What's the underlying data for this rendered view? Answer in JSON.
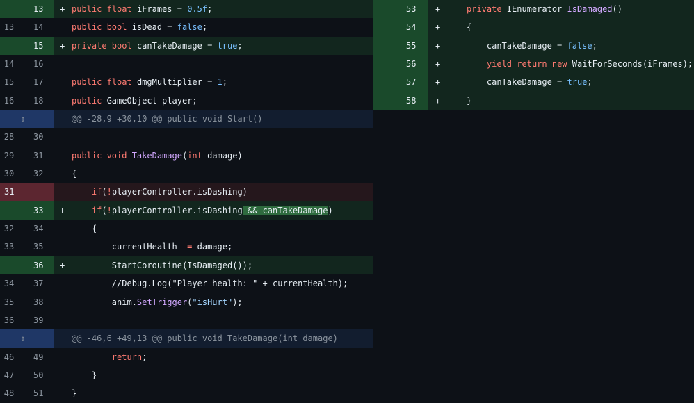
{
  "left_pane": {
    "rows": [
      {
        "type": "add",
        "old": "",
        "new": "13",
        "sign": "+",
        "code": [
          {
            "t": "public ",
            "c": "kw"
          },
          {
            "t": "float ",
            "c": "kw"
          },
          {
            "t": "iFrames = ",
            "c": ""
          },
          {
            "t": "0.5f",
            "c": "num-l"
          },
          {
            "t": ";",
            "c": ""
          }
        ]
      },
      {
        "type": "ctx",
        "old": "13",
        "new": "14",
        "sign": "",
        "code": [
          {
            "t": "public ",
            "c": "kw"
          },
          {
            "t": "bool ",
            "c": "kw"
          },
          {
            "t": "isDead = ",
            "c": ""
          },
          {
            "t": "false",
            "c": "num-l"
          },
          {
            "t": ";",
            "c": ""
          }
        ]
      },
      {
        "type": "add",
        "old": "",
        "new": "15",
        "sign": "+",
        "code": [
          {
            "t": "private ",
            "c": "kw"
          },
          {
            "t": "bool ",
            "c": "kw"
          },
          {
            "t": "canTakeDamage = ",
            "c": ""
          },
          {
            "t": "true",
            "c": "num-l"
          },
          {
            "t": ";",
            "c": ""
          }
        ]
      },
      {
        "type": "ctx",
        "old": "14",
        "new": "16",
        "sign": "",
        "code": []
      },
      {
        "type": "ctx",
        "old": "15",
        "new": "17",
        "sign": "",
        "code": [
          {
            "t": "public ",
            "c": "kw"
          },
          {
            "t": "float ",
            "c": "kw"
          },
          {
            "t": "dmgMultiplier = ",
            "c": ""
          },
          {
            "t": "1",
            "c": "num-l"
          },
          {
            "t": ";",
            "c": ""
          }
        ]
      },
      {
        "type": "ctx",
        "old": "16",
        "new": "18",
        "sign": "",
        "code": [
          {
            "t": "public ",
            "c": "kw"
          },
          {
            "t": "GameObject player;",
            "c": ""
          }
        ]
      },
      {
        "type": "hunk",
        "old": "",
        "new": "",
        "sign": "",
        "code": [
          {
            "t": "@@ -28,9 +30,10 @@ public void Start()",
            "c": ""
          }
        ]
      },
      {
        "type": "ctx",
        "old": "28",
        "new": "30",
        "sign": "",
        "code": []
      },
      {
        "type": "ctx",
        "old": "29",
        "new": "31",
        "sign": "",
        "code": [
          {
            "t": "public ",
            "c": "kw"
          },
          {
            "t": "void ",
            "c": "kw"
          },
          {
            "t": "TakeDamage",
            "c": "fn"
          },
          {
            "t": "(",
            "c": ""
          },
          {
            "t": "int ",
            "c": "kw"
          },
          {
            "t": "damage)",
            "c": ""
          }
        ]
      },
      {
        "type": "ctx",
        "old": "30",
        "new": "32",
        "sign": "",
        "code": [
          {
            "t": "{",
            "c": ""
          }
        ]
      },
      {
        "type": "del",
        "old": "31",
        "new": "",
        "sign": "-",
        "code": [
          {
            "t": "    ",
            "c": ""
          },
          {
            "t": "if",
            "c": "kw"
          },
          {
            "t": "(",
            "c": ""
          },
          {
            "t": "!",
            "c": "kw"
          },
          {
            "t": "playerController.isDashing)",
            "c": ""
          }
        ]
      },
      {
        "type": "add",
        "old": "",
        "new": "33",
        "sign": "+",
        "code": [
          {
            "t": "    ",
            "c": ""
          },
          {
            "t": "if",
            "c": "kw"
          },
          {
            "t": "(",
            "c": ""
          },
          {
            "t": "!",
            "c": "kw"
          },
          {
            "t": "playerController.isDashing",
            "c": ""
          },
          {
            "t": " && canTakeDamage",
            "c": "hl"
          },
          {
            "t": ")",
            "c": ""
          }
        ]
      },
      {
        "type": "ctx",
        "old": "32",
        "new": "34",
        "sign": "",
        "code": [
          {
            "t": "    {",
            "c": ""
          }
        ]
      },
      {
        "type": "ctx",
        "old": "33",
        "new": "35",
        "sign": "",
        "code": [
          {
            "t": "        currentHealth ",
            "c": ""
          },
          {
            "t": "-=",
            "c": "kw"
          },
          {
            "t": " damage;",
            "c": ""
          }
        ]
      },
      {
        "type": "add",
        "old": "",
        "new": "36",
        "sign": "+",
        "code": [
          {
            "t": "        StartCoroutine(IsDamaged());",
            "c": ""
          }
        ]
      },
      {
        "type": "ctx",
        "old": "34",
        "new": "37",
        "sign": "",
        "code": [
          {
            "t": "        //Debug.Log(\"Player health: \" + currentHealth);",
            "c": "cm"
          }
        ]
      },
      {
        "type": "ctx",
        "old": "35",
        "new": "38",
        "sign": "",
        "code": [
          {
            "t": "        anim.",
            "c": ""
          },
          {
            "t": "SetTrigger",
            "c": "fn"
          },
          {
            "t": "(",
            "c": ""
          },
          {
            "t": "\"isHurt\"",
            "c": "str"
          },
          {
            "t": ");",
            "c": ""
          }
        ]
      },
      {
        "type": "ctx",
        "old": "36",
        "new": "39",
        "sign": "",
        "code": []
      },
      {
        "type": "hunk",
        "old": "",
        "new": "",
        "sign": "",
        "code": [
          {
            "t": "@@ -46,6 +49,13 @@ public void TakeDamage(int damage)",
            "c": ""
          }
        ]
      },
      {
        "type": "ctx",
        "old": "46",
        "new": "49",
        "sign": "",
        "code": [
          {
            "t": "        ",
            "c": ""
          },
          {
            "t": "return",
            "c": "kw"
          },
          {
            "t": ";",
            "c": ""
          }
        ]
      },
      {
        "type": "ctx",
        "old": "47",
        "new": "50",
        "sign": "",
        "code": [
          {
            "t": "    }",
            "c": ""
          }
        ]
      },
      {
        "type": "ctx",
        "old": "48",
        "new": "51",
        "sign": "",
        "code": [
          {
            "t": "}",
            "c": ""
          }
        ]
      }
    ]
  },
  "right_pane": {
    "rows": [
      {
        "type": "add",
        "new": "53",
        "sign": "+",
        "code": [
          {
            "t": "private ",
            "c": "kw"
          },
          {
            "t": "IEnumerator ",
            "c": ""
          },
          {
            "t": "IsDamaged",
            "c": "fn"
          },
          {
            "t": "()",
            "c": ""
          }
        ]
      },
      {
        "type": "add",
        "new": "54",
        "sign": "+",
        "code": [
          {
            "t": "{",
            "c": ""
          }
        ]
      },
      {
        "type": "add",
        "new": "55",
        "sign": "+",
        "code": [
          {
            "t": "    canTakeDamage = ",
            "c": ""
          },
          {
            "t": "false",
            "c": "num-l"
          },
          {
            "t": ";",
            "c": ""
          }
        ]
      },
      {
        "type": "add",
        "new": "56",
        "sign": "+",
        "code": [
          {
            "t": "    ",
            "c": ""
          },
          {
            "t": "yield ",
            "c": "kw"
          },
          {
            "t": "return ",
            "c": "kw"
          },
          {
            "t": "new ",
            "c": "kw"
          },
          {
            "t": "WaitForSeconds(iFrames);",
            "c": ""
          }
        ]
      },
      {
        "type": "add",
        "new": "57",
        "sign": "+",
        "code": [
          {
            "t": "    canTakeDamage = ",
            "c": ""
          },
          {
            "t": "true",
            "c": "num-l"
          },
          {
            "t": ";",
            "c": ""
          }
        ]
      },
      {
        "type": "add",
        "new": "58",
        "sign": "+",
        "code": [
          {
            "t": "}",
            "c": ""
          }
        ]
      }
    ]
  },
  "colors": {
    "add_bg": "#12261e",
    "del_bg": "#25171c",
    "hunk_bg": "#121d2f",
    "keyword": "#ff7b72",
    "function": "#d2a8ff"
  },
  "icons": {
    "hunk_expand": "unfold-icon"
  }
}
